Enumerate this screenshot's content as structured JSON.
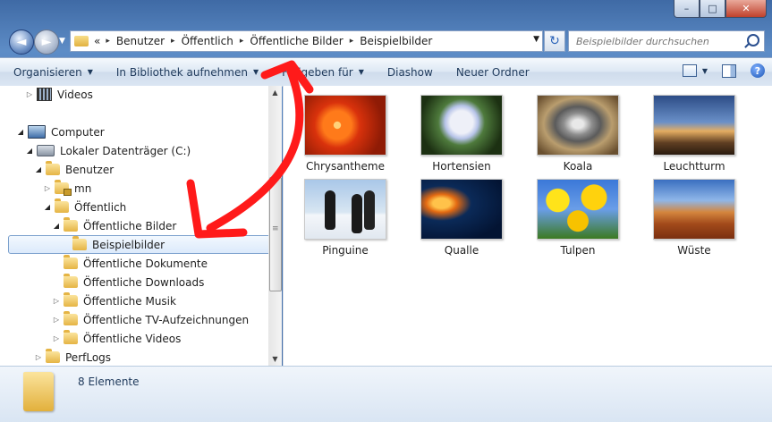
{
  "window": {
    "controls": {
      "minimize": "–",
      "maximize": "□",
      "close": "✕"
    }
  },
  "nav": {
    "back_glyph": "◄",
    "forward_glyph": "►",
    "breadcrumb": [
      "«",
      "Benutzer",
      "Öffentlich",
      "Öffentliche Bilder",
      "Beispielbilder"
    ],
    "separator": "▸",
    "search_placeholder": "Beispielbilder durchsuchen"
  },
  "commands": [
    {
      "label": "Organisieren",
      "dropdown": true
    },
    {
      "label": "In Bibliothek aufnehmen",
      "dropdown": true
    },
    {
      "label": "Freigeben für",
      "dropdown": true
    },
    {
      "label": "Diashow",
      "dropdown": false
    },
    {
      "label": "Neuer Ordner",
      "dropdown": false
    }
  ],
  "tree": [
    {
      "label": "Videos",
      "icon": "video-icon",
      "level": 1,
      "arrow": "collapsed"
    },
    {
      "label": "Computer",
      "icon": "computer-icon",
      "level": 0,
      "arrow": "expanded"
    },
    {
      "label": "Lokaler Datenträger (C:)",
      "icon": "drive-icon",
      "level": 1,
      "arrow": "expanded"
    },
    {
      "label": "Benutzer",
      "icon": "folder-icon",
      "level": 2,
      "arrow": "expanded"
    },
    {
      "label": "mn",
      "icon": "locked-folder-icon",
      "level": 3,
      "arrow": "collapsed"
    },
    {
      "label": "Öffentlich",
      "icon": "folder-icon",
      "level": 3,
      "arrow": "expanded"
    },
    {
      "label": "Öffentliche Bilder",
      "icon": "folder-icon",
      "level": 4,
      "arrow": "expanded"
    },
    {
      "label": "Beispielbilder",
      "icon": "folder-icon",
      "level": 5,
      "arrow": "none",
      "selected": true
    },
    {
      "label": "Öffentliche Dokumente",
      "icon": "folder-icon",
      "level": 4,
      "arrow": "none"
    },
    {
      "label": "Öffentliche Downloads",
      "icon": "folder-icon",
      "level": 4,
      "arrow": "none"
    },
    {
      "label": "Öffentliche Musik",
      "icon": "folder-icon",
      "level": 4,
      "arrow": "collapsed"
    },
    {
      "label": "Öffentliche TV-Aufzeichnungen",
      "icon": "folder-icon",
      "level": 4,
      "arrow": "collapsed"
    },
    {
      "label": "Öffentliche Videos",
      "icon": "folder-icon",
      "level": 4,
      "arrow": "collapsed"
    },
    {
      "label": "PerfLogs",
      "icon": "folder-icon",
      "level": 2,
      "arrow": "collapsed"
    }
  ],
  "files": [
    {
      "name": "Chrysantheme",
      "thumb": "chrysantheme-image"
    },
    {
      "name": "Hortensien",
      "thumb": "hortensien-image"
    },
    {
      "name": "Koala",
      "thumb": "koala-image"
    },
    {
      "name": "Leuchtturm",
      "thumb": "leuchtturm-image"
    },
    {
      "name": "Pinguine",
      "thumb": "pinguine-image"
    },
    {
      "name": "Qualle",
      "thumb": "qualle-image"
    },
    {
      "name": "Tulpen",
      "thumb": "tulpen-image"
    },
    {
      "name": "Wüste",
      "thumb": "wueste-image"
    }
  ],
  "status": {
    "item_count": "8 Elemente"
  },
  "annotation": {
    "color": "#ff1a1a",
    "shape": "double-headed-arrow"
  }
}
